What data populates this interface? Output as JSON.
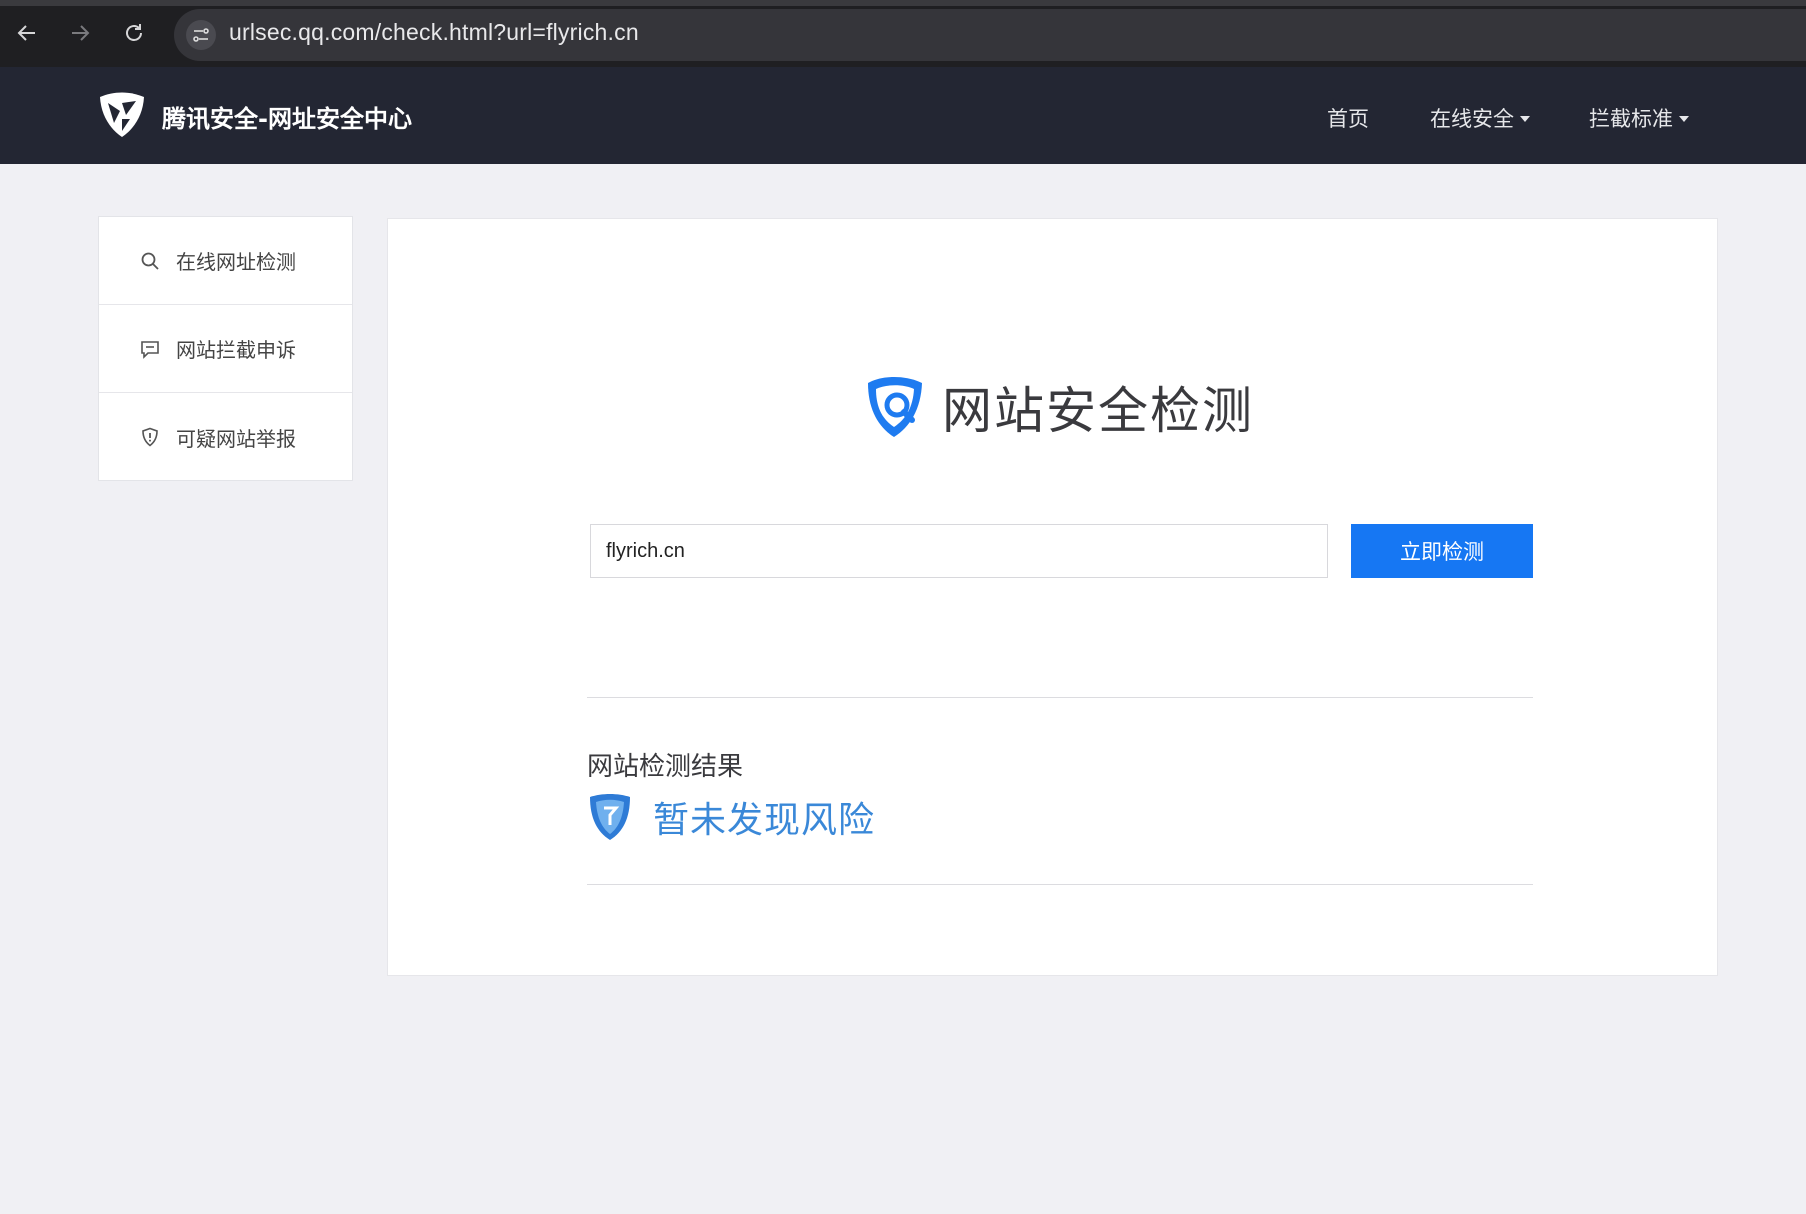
{
  "browser": {
    "url": "urlsec.qq.com/check.html?url=flyrich.cn",
    "icons": [
      "back-arrow-icon",
      "forward-arrow-icon",
      "reload-icon",
      "site-info-icon"
    ]
  },
  "header": {
    "site_title": "腾讯安全-网址安全中心",
    "nav": {
      "home": "首页",
      "online_security": "在线安全",
      "block_standard": "拦截标准"
    }
  },
  "sidebar": {
    "items": [
      {
        "label": "在线网址检测",
        "icon": "search-icon"
      },
      {
        "label": "网站拦截申诉",
        "icon": "message-icon"
      },
      {
        "label": "可疑网站举报",
        "icon": "shield-alert-icon"
      }
    ]
  },
  "main": {
    "title": "网站安全检测",
    "search_value": "flyrich.cn",
    "button_label": "立即检测",
    "result_heading": "网站检测结果",
    "result_text": "暂未发现风险"
  },
  "colors": {
    "header_bg": "#232633",
    "accent": "#1677f3",
    "result_text": "#3a88d8",
    "page_bg": "#f0f0f4"
  }
}
